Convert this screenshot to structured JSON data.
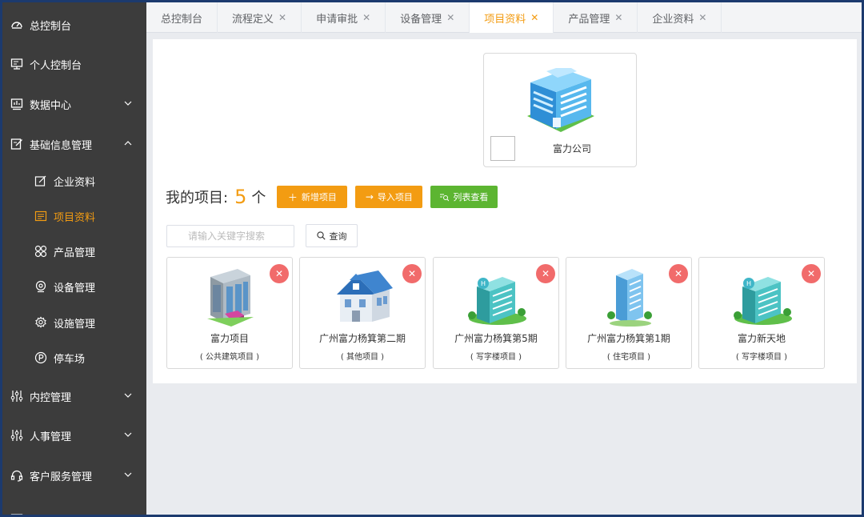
{
  "sidebar": {
    "items": [
      {
        "label": "总控制台",
        "icon": "dashboard-icon"
      },
      {
        "label": "个人控制台",
        "icon": "monitor-icon"
      },
      {
        "label": "数据中心",
        "icon": "data-chart-icon",
        "expandable": true
      },
      {
        "label": "基础信息管理",
        "icon": "edit-icon",
        "expanded": true
      },
      {
        "label": "内控管理",
        "icon": "sliders-icon",
        "expandable": true
      },
      {
        "label": "人事管理",
        "icon": "sliders-icon",
        "expandable": true
      },
      {
        "label": "客户服务管理",
        "icon": "headset-icon",
        "expandable": true
      }
    ],
    "sub_items": [
      {
        "label": "企业资料",
        "icon": "edit-doc-icon"
      },
      {
        "label": "项目资料",
        "icon": "list-icon",
        "active": true
      },
      {
        "label": "产品管理",
        "icon": "apps-icon"
      },
      {
        "label": "设备管理",
        "icon": "device-icon"
      },
      {
        "label": "设施管理",
        "icon": "gear-icon"
      },
      {
        "label": "停车场",
        "icon": "parking-icon"
      }
    ]
  },
  "tabs": [
    {
      "label": "总控制台",
      "closable": false
    },
    {
      "label": "流程定义",
      "closable": true
    },
    {
      "label": "申请审批",
      "closable": true
    },
    {
      "label": "设备管理",
      "closable": true
    },
    {
      "label": "项目资料",
      "closable": true,
      "active": true
    },
    {
      "label": "产品管理",
      "closable": true
    },
    {
      "label": "企业资料",
      "closable": true
    }
  ],
  "company": {
    "name": "富力公司"
  },
  "projects_header": {
    "label": "我的项目:",
    "count": "5",
    "unit": "个",
    "add_button": "新增项目",
    "import_button": "导入项目",
    "list_button": "列表查看"
  },
  "search": {
    "placeholder": "请输入关键字搜索",
    "value": "",
    "button": "查询"
  },
  "projects": [
    {
      "name": "富力项目",
      "type": "( 公共建筑项目 )",
      "image": "public-building-icon"
    },
    {
      "name": "广州富力杨箕第二期",
      "type": "( 其他项目 )",
      "image": "house-icon"
    },
    {
      "name": "广州富力杨箕第5期",
      "type": "( 写字楼项目 )",
      "image": "office-building-icon"
    },
    {
      "name": "广州富力杨箕第1期",
      "type": "( 住宅项目 )",
      "image": "residential-tower-icon"
    },
    {
      "name": "富力新天地",
      "type": "( 写字楼项目 )",
      "image": "office-building-icon"
    }
  ],
  "colors": {
    "accent": "#f39c12",
    "green": "#5cb531",
    "danger": "#f16b6b",
    "sidebar": "#3c3c3c"
  }
}
